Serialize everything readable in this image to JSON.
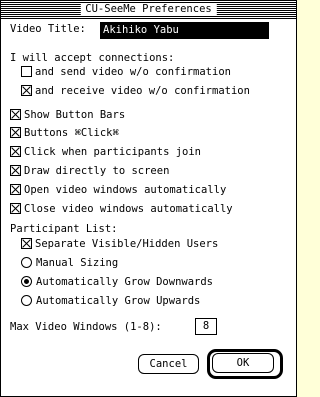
{
  "window": {
    "title": "CU-SeeMe Preferences"
  },
  "video_title": {
    "label": "Video Title:",
    "value": "Akihiko Yabu"
  },
  "connections": {
    "heading": "I will accept connections:",
    "send_without_confirm": {
      "label": "and send video w/o confirmation",
      "checked": false
    },
    "receive_without_confirm": {
      "label": "and receive video w/o confirmation",
      "checked": true
    }
  },
  "options": [
    {
      "label": "Show Button Bars",
      "checked": true
    },
    {
      "label": "Buttons ⌘Click⌘",
      "checked": true
    },
    {
      "label": "Click when participants join",
      "checked": true
    },
    {
      "label": "Draw directly to screen",
      "checked": true
    },
    {
      "label": "Open video windows automatically",
      "checked": true
    },
    {
      "label": "Close video windows automatically",
      "checked": true
    }
  ],
  "participant_list": {
    "heading": "Participant List:",
    "separate_visible_hidden": {
      "label": "Separate Visible/Hidden Users",
      "checked": true
    },
    "sizing_options": [
      {
        "label": "Manual Sizing",
        "selected": false
      },
      {
        "label": "Automatically Grow Downwards",
        "selected": true
      },
      {
        "label": "Automatically Grow Upwards",
        "selected": false
      }
    ]
  },
  "max_video_windows": {
    "label": "Max Video Windows (1-8):",
    "value": "8"
  },
  "buttons": {
    "cancel": "Cancel",
    "ok": "OK"
  }
}
